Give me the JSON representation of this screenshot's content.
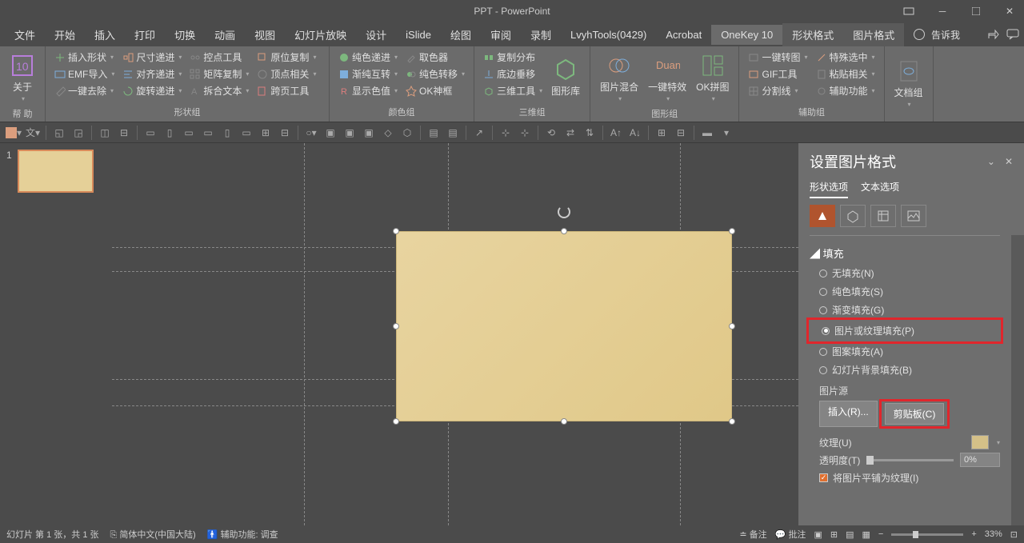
{
  "title": "PPT - PowerPoint",
  "menu": {
    "file": "文件",
    "home": "开始",
    "insert": "插入",
    "print": "打印",
    "trans": "切换",
    "anim": "动画",
    "view": "视图",
    "slideshow": "幻灯片放映",
    "design": "设计",
    "islide": "iSlide",
    "draw": "绘图",
    "review": "审阅",
    "record": "录制",
    "lvyh": "LvyhTools(0429)",
    "acrobat": "Acrobat",
    "onekey": "OneKey 10",
    "shapefmt": "形状格式",
    "picfmt": "图片格式",
    "tellme": "告诉我"
  },
  "ribbon": {
    "help_group": "帮 助",
    "about": "关于",
    "shape_group": "形状组",
    "insert_shape": "插入形状",
    "emf_import": "EMF导入",
    "one_click_remove": "一键去除",
    "size_iter": "尺寸递进",
    "align_iter": "对齐递进",
    "rotate_iter": "旋转递进",
    "control_tool": "控点工具",
    "matrix_copy": "矩阵复制",
    "split_text": "拆合文本",
    "orig_copy": "原位复制",
    "vertex_rel": "顶点相关",
    "cross_page": "跨页工具",
    "color_group": "颜色组",
    "solid_iter": "纯色递进",
    "grad_swap": "渐纯互转",
    "show_color": "显示色值",
    "picker": "取色器",
    "color_trans": "纯色转移",
    "ok_god": "OK神框",
    "three_d_group": "三维组",
    "copy_dist": "复制分布",
    "bottom_shift": "底边垂移",
    "three_d_tool": "三维工具",
    "shape_lib_group": "图形组",
    "shape_lib": "图形库",
    "pic_blend": "图片混合",
    "one_fx": "一键特效",
    "ok_pin": "OK拼图",
    "aux_group": "辅助组",
    "one_rotate": "一键转图",
    "gif_tool": "GIF工具",
    "split_line": "分割线",
    "special_sel": "特殊选中",
    "paste_rel": "粘贴相关",
    "aux_func": "辅助功能",
    "doc_group": "文档组"
  },
  "panel": {
    "title": "设置图片格式",
    "tab_shape": "形状选项",
    "tab_text": "文本选项",
    "section_fill": "填充",
    "no_fill": "无填充(N)",
    "solid_fill": "纯色填充(S)",
    "grad_fill": "渐变填充(G)",
    "pic_fill": "图片或纹理填充(P)",
    "pattern_fill": "图案填充(A)",
    "slide_bg": "幻灯片背景填充(B)",
    "pic_source": "图片源",
    "insert_r": "插入(R)...",
    "clipboard_c": "剪贴板(C)",
    "texture": "纹理(U)",
    "transparency": "透明度(T)",
    "trans_val": "0%",
    "tile": "将图片平铺为纹理(I)"
  },
  "status": {
    "slide_info": "幻灯片 第 1 张，共 1 张",
    "lang": "简体中文(中国大陆)",
    "access": "辅助功能: 调查",
    "notes": "备注",
    "comments": "批注",
    "zoom": "33%"
  },
  "thumb": {
    "num": "1"
  }
}
